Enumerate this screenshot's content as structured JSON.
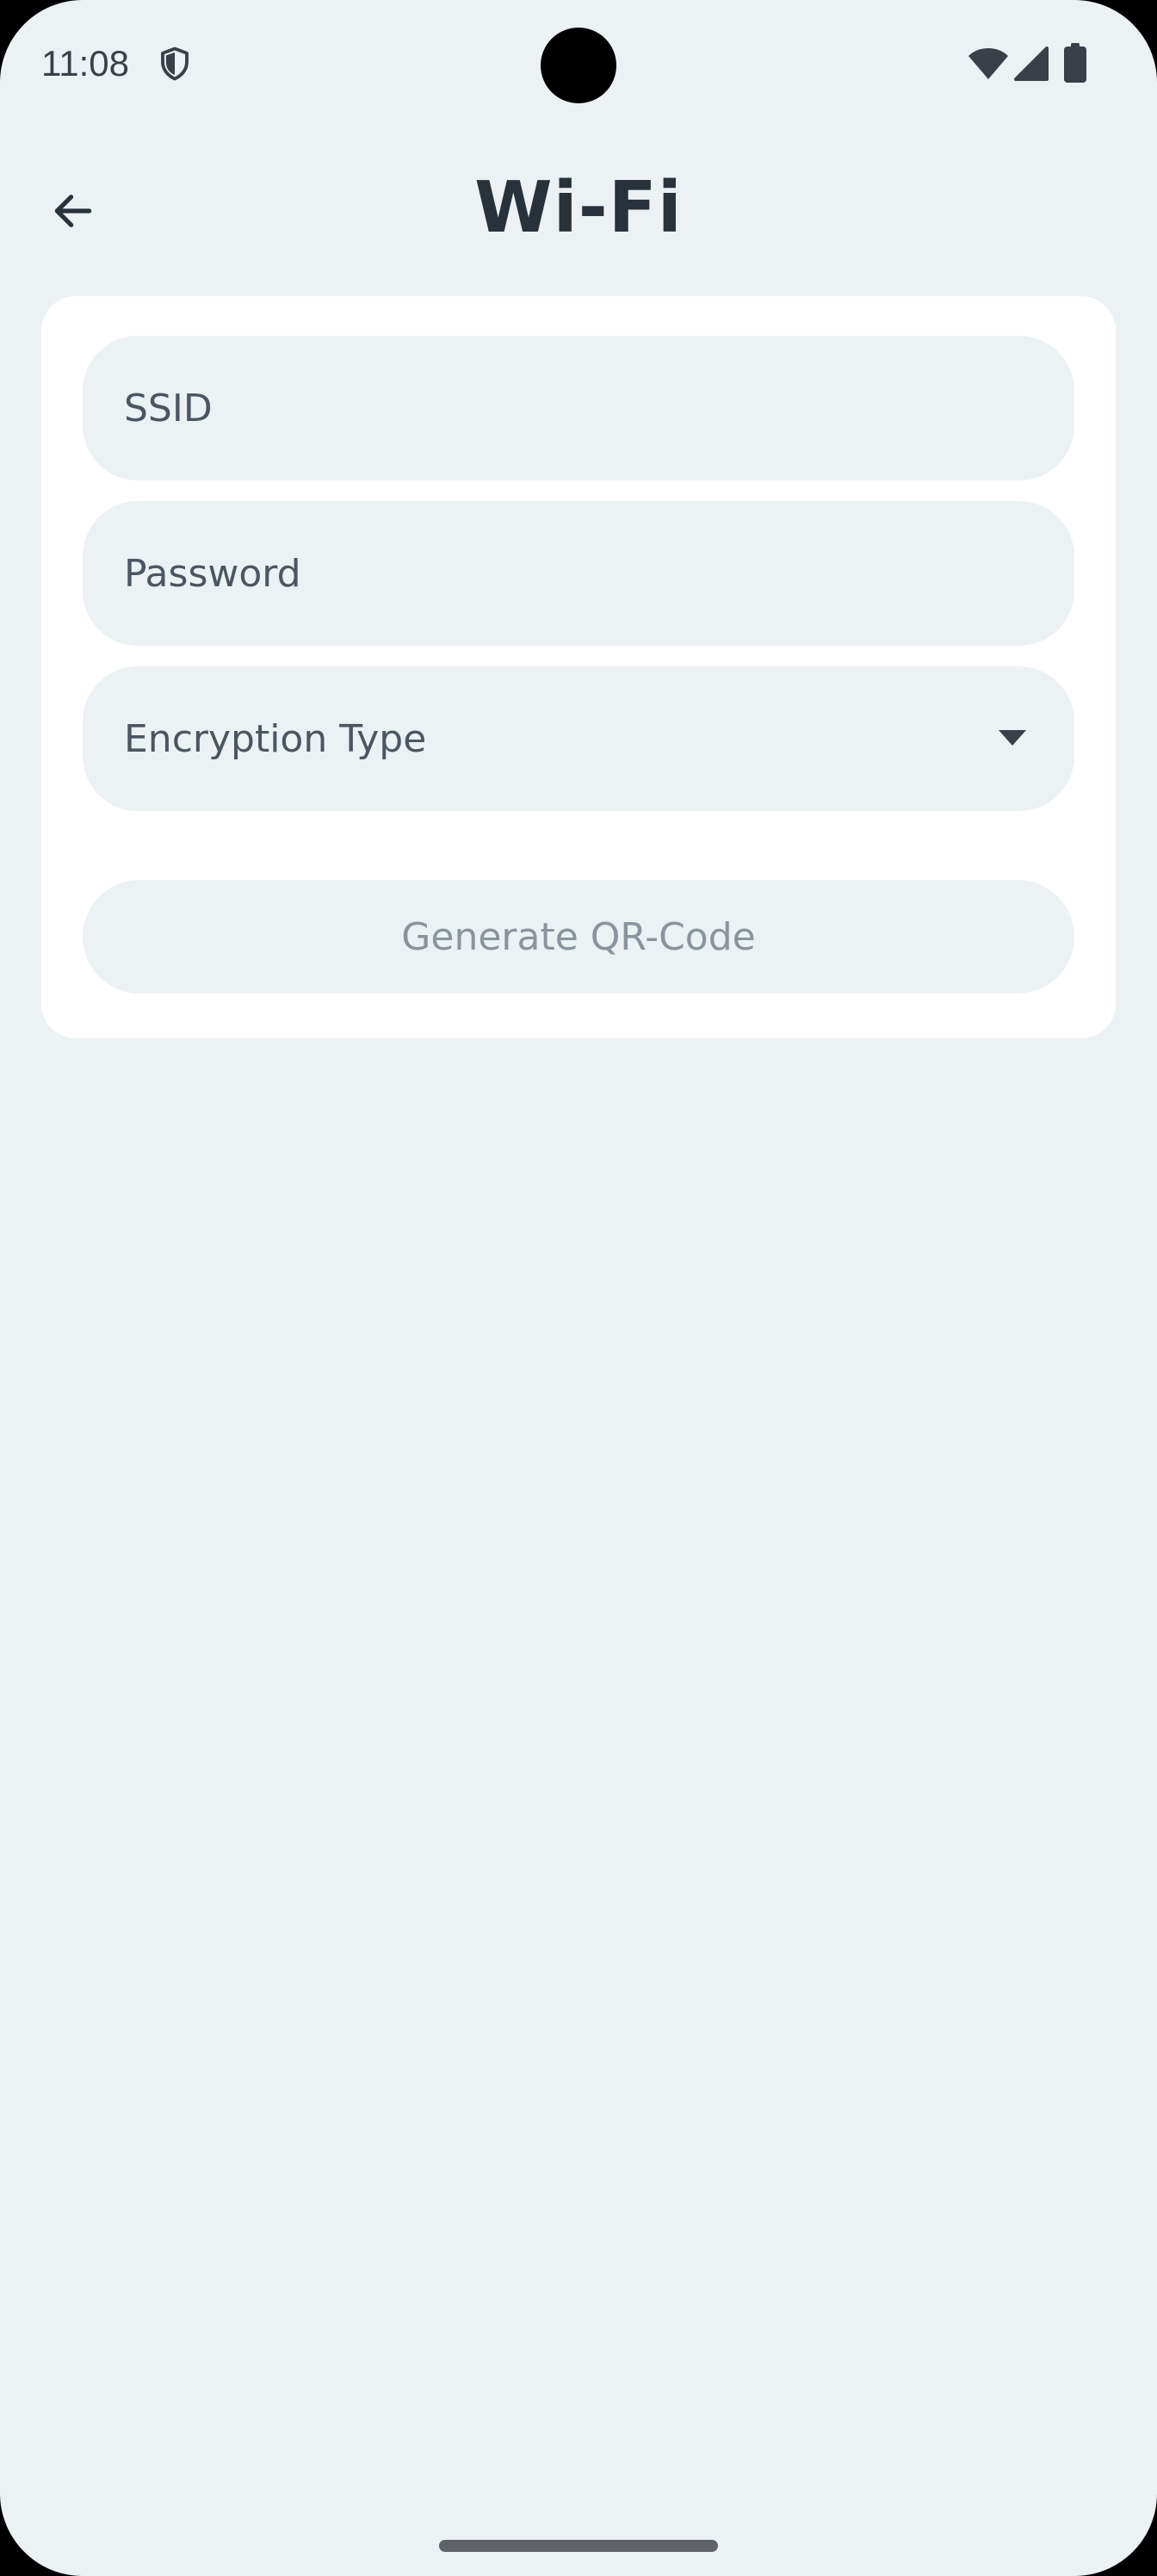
{
  "status_bar": {
    "time": "11:08",
    "icons": [
      "shield-icon",
      "wifi-icon",
      "signal-icon",
      "battery-icon"
    ]
  },
  "app_bar": {
    "title": "Wi-Fi",
    "back_icon": "arrow-left-icon"
  },
  "form": {
    "ssid_label": "SSID",
    "ssid_value": "",
    "password_label": "Password",
    "password_value": "",
    "encryption_label": "Encryption Type",
    "encryption_value": "",
    "generate_label": "Generate QR-Code",
    "generate_enabled": false
  },
  "colors": {
    "background": "#ecf1f4",
    "card": "#ffffff",
    "title": "#27323a",
    "field_label": "#4c5660",
    "disabled_text": "#8a949c"
  }
}
